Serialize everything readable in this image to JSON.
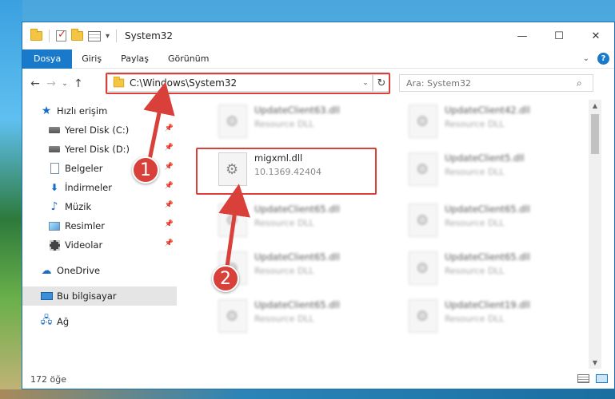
{
  "window": {
    "title": "System32",
    "controls": {
      "minimize": "—",
      "maximize": "☐",
      "close": "✕"
    }
  },
  "ribbon": {
    "tabs": [
      "Dosya",
      "Giriş",
      "Paylaş",
      "Görünüm"
    ],
    "active_tab": "Dosya",
    "help": "?"
  },
  "address": {
    "path": "C:\\Windows\\System32",
    "search_placeholder": "Ara: System32"
  },
  "sidebar": {
    "quick_access": "Hızlı erişim",
    "items": [
      {
        "label": "Yerel Disk (C:)",
        "icon": "drive-icon"
      },
      {
        "label": "Yerel Disk (D:)",
        "icon": "drive-icon"
      },
      {
        "label": "Belgeler",
        "icon": "document-icon"
      },
      {
        "label": "İndirmeler",
        "icon": "download-icon"
      },
      {
        "label": "Müzik",
        "icon": "music-icon"
      },
      {
        "label": "Resimler",
        "icon": "pictures-icon"
      },
      {
        "label": "Videolar",
        "icon": "video-icon"
      }
    ],
    "onedrive": "OneDrive",
    "this_pc": "Bu bilgisayar",
    "network": "Ağ"
  },
  "files": [
    {
      "name": "UpdateClient63.dll",
      "desc": "Resource DLL"
    },
    {
      "name": "UpdateClient42.dll",
      "desc": "Resource DLL"
    },
    {
      "name": "migxml.dll",
      "desc": "10.1369.42404"
    },
    {
      "name": "UpdateClient5.dll",
      "desc": "Resource DLL"
    },
    {
      "name": "UpdateClient65.dll",
      "desc": "Resource DLL"
    },
    {
      "name": "UpdateClient65.dll",
      "desc": "Resource DLL"
    },
    {
      "name": "UpdateClient65.dll",
      "desc": "Resource DLL"
    },
    {
      "name": "UpdateClient65.dll",
      "desc": "Resource DLL"
    },
    {
      "name": "UpdateClient65.dll",
      "desc": "Resource DLL"
    },
    {
      "name": "UpdateClient19.dll",
      "desc": "Resource DLL"
    }
  ],
  "status": {
    "count": "172 öğe"
  },
  "annotations": {
    "step1": "1",
    "step2": "2",
    "color": "#d9403a"
  }
}
